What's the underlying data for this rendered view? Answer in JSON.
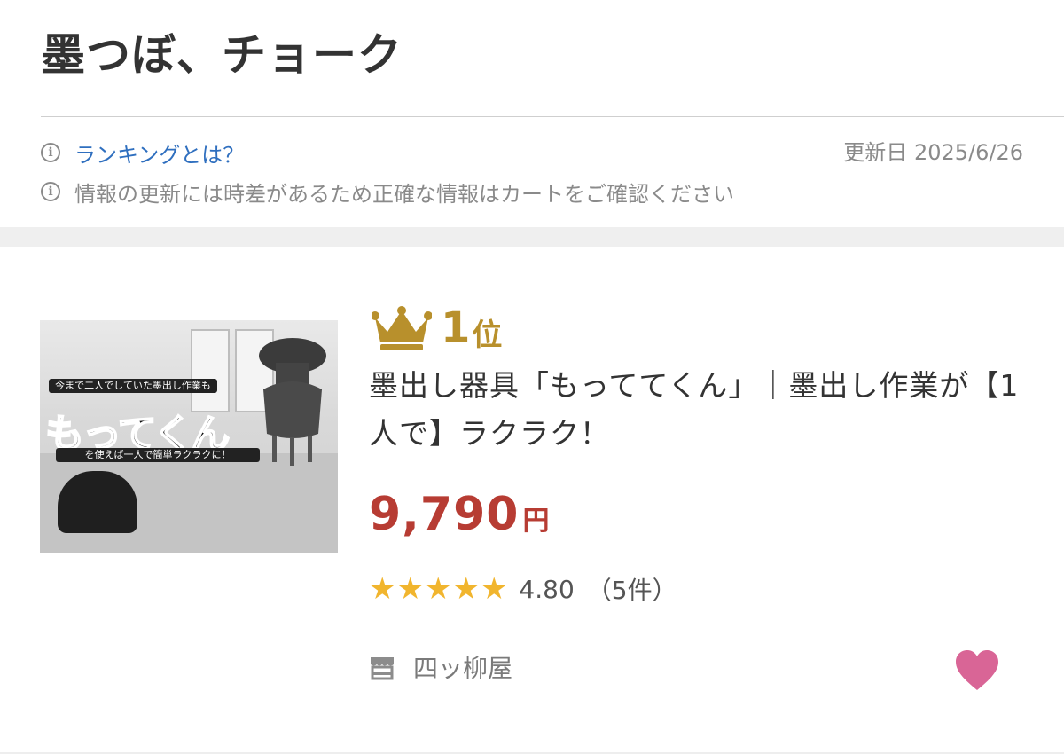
{
  "header": {
    "title": "墨つぼ、チョーク"
  },
  "info": {
    "ranking_link": "ランキングとは？",
    "updated": "更新日 2025/6/26",
    "notice": "情報の更新には時差があるため正確な情報はカートをご確認ください",
    "info_icon_glyph": "i"
  },
  "product": {
    "rank_number": "1",
    "rank_unit": "位",
    "title": "墨出し器具「もっててくん」｜墨出し作業が【1人で】ラクラク！",
    "price": "9,790",
    "price_unit": "円",
    "rating_stars": 5,
    "rating_value": "4.80",
    "review_count": "（5件）",
    "shop_name": "四ッ柳屋",
    "thumbnail": {
      "banner_top": "今まで二人でしていた墨出し作業も",
      "logo": "もってくん",
      "banner_bottom": "を使えば一人で簡単ラクラクに！"
    }
  },
  "colors": {
    "rank_gold": "#b8902c",
    "price_red": "#b73c33",
    "star_yellow": "#f1b52e",
    "link_blue": "#2f6fbf",
    "heart_pink": "#d96596"
  },
  "icons": {
    "info": "info-circle-icon",
    "crown": "crown-icon",
    "star": "star-icon",
    "shop": "shop-icon",
    "heart": "heart-icon"
  }
}
